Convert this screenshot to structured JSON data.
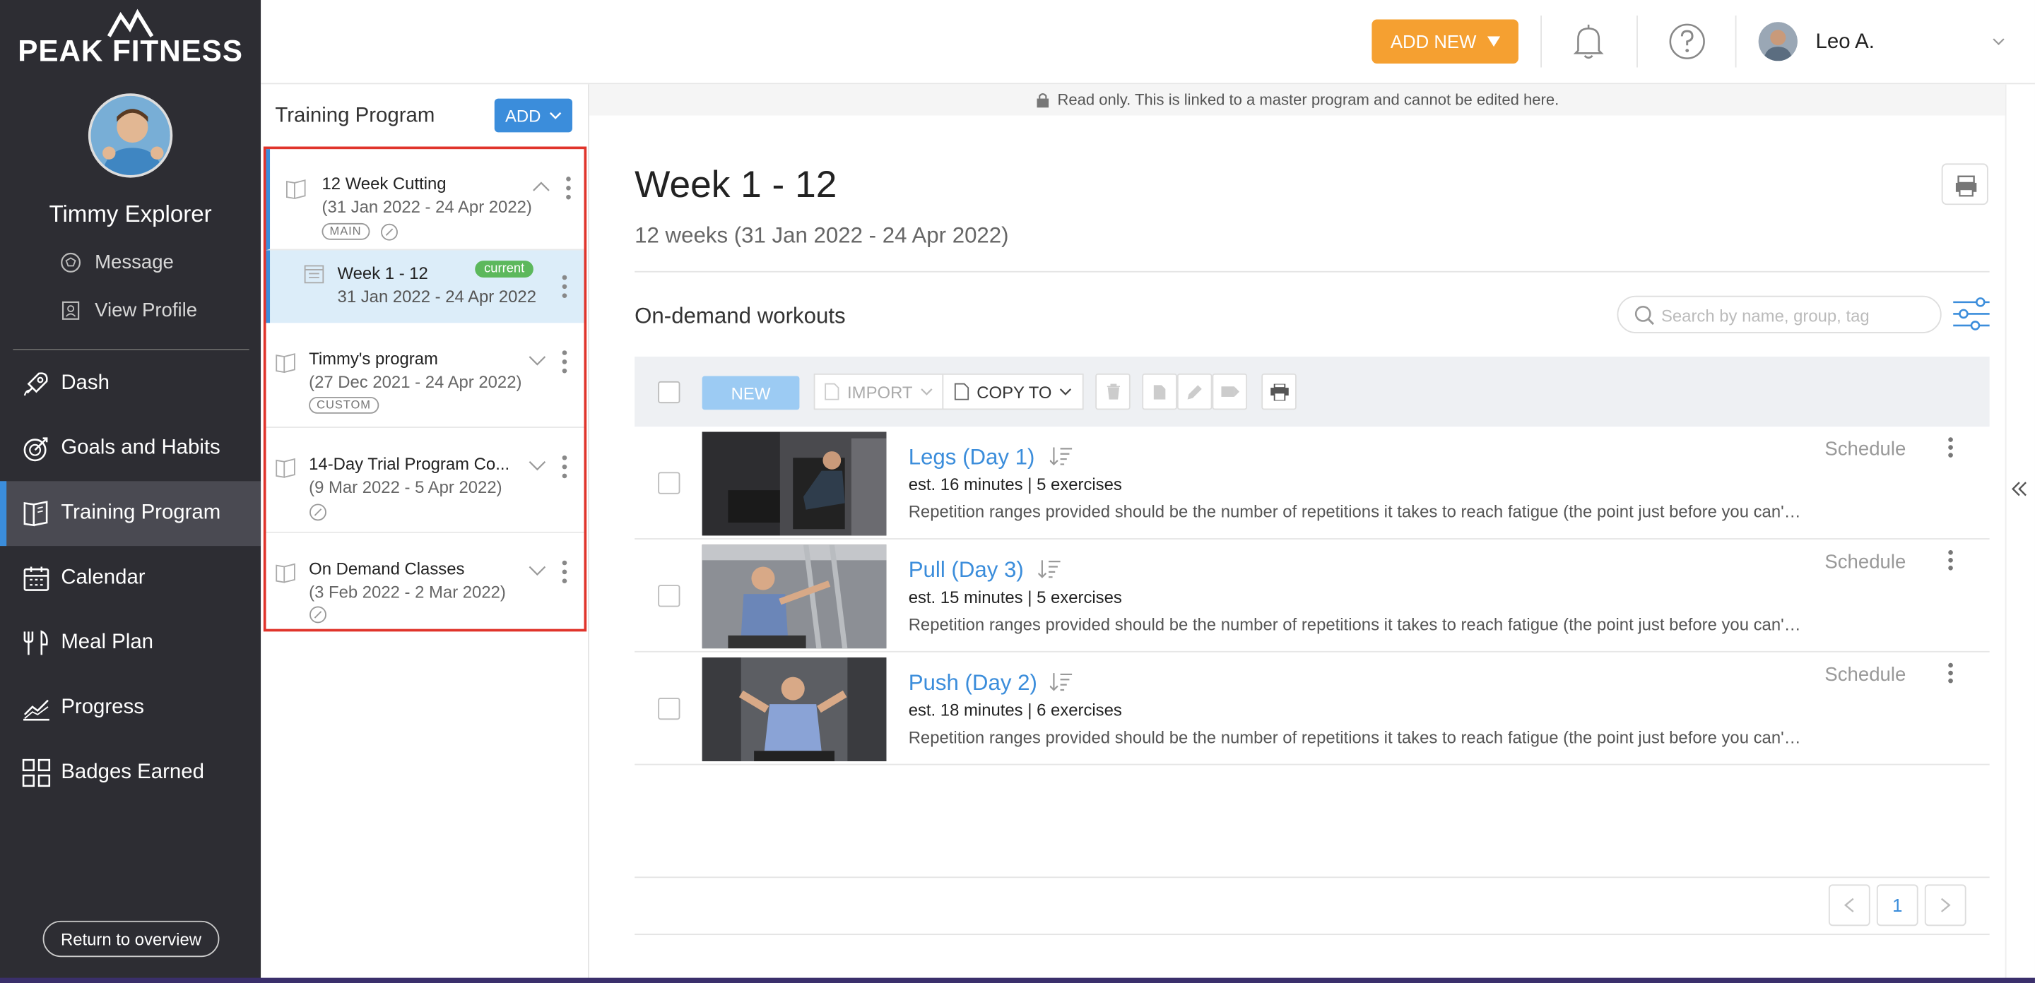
{
  "brand": {
    "name": "PEAK FITNESS"
  },
  "client": {
    "name": "Timmy Explorer",
    "message_label": "Message",
    "profile_label": "View Profile"
  },
  "nav": [
    {
      "label": "Dash",
      "icon": "rocket-icon"
    },
    {
      "label": "Goals and Habits",
      "icon": "target-icon"
    },
    {
      "label": "Training Program",
      "icon": "book-icon",
      "active": true
    },
    {
      "label": "Calendar",
      "icon": "calendar-icon"
    },
    {
      "label": "Meal Plan",
      "icon": "fork-knife-icon"
    },
    {
      "label": "Progress",
      "icon": "chart-icon"
    },
    {
      "label": "Badges Earned",
      "icon": "grid-icon"
    }
  ],
  "return_label": "Return to overview",
  "topbar": {
    "add_new_label": "ADD NEW",
    "user_name": "Leo A."
  },
  "panel": {
    "title": "Training Program",
    "add_label": "ADD",
    "programs": [
      {
        "name": "12 Week Cutting",
        "dates": "(31 Jan 2022 - 24 Apr 2022)",
        "tag": "MAIN"
      },
      {
        "name": "Timmy's program",
        "dates": "(27 Dec 2021 - 24 Apr 2022)",
        "tag": "CUSTOM"
      },
      {
        "name": "14-Day Trial Program Co...",
        "dates": "(9 Mar 2022 - 5 Apr 2022)",
        "tag": ""
      },
      {
        "name": "On Demand Classes",
        "dates": "(3 Feb 2022 - 2 Mar 2022)",
        "tag": ""
      }
    ],
    "week": {
      "name": "Week 1 - 12",
      "dates": "31 Jan 2022 - 24 Apr 2022",
      "badge": "current"
    }
  },
  "main": {
    "banner": "Read only. This is linked to a master program and cannot be edited here.",
    "title": "Week 1 - 12",
    "subtitle": "12 weeks (31 Jan 2022 - 24 Apr 2022)",
    "section_title": "On-demand workouts",
    "search_placeholder": "Search by name, group, tag",
    "toolbar": {
      "new_label": "NEW",
      "import_label": "IMPORT",
      "copy_label": "COPY TO"
    },
    "schedule_label": "Schedule",
    "workouts": [
      {
        "name": "Legs (Day 1)",
        "meta": "est. 16 minutes | 5 exercises",
        "desc": "Repetition ranges provided should be the number of repetitions it takes to reach fatigue (the point just before you can't do another rep with good form)."
      },
      {
        "name": "Pull (Day 3)",
        "meta": "est. 15 minutes | 5 exercises",
        "desc": "Repetition ranges provided should be the number of repetitions it takes to reach fatigue (the point just before you can't do another rep with good form)."
      },
      {
        "name": "Push (Day 2)",
        "meta": "est. 18 minutes | 6 exercises",
        "desc": "Repetition ranges provided should be the number of repetitions it takes to reach fatigue (the point just before you can't do another rep with good form)."
      }
    ],
    "page_number": "1"
  },
  "colors": {
    "accent": "#3b8ddb",
    "orange": "#f5a031",
    "sidebar": "#2d2d33",
    "highlight": "#e0342b"
  }
}
